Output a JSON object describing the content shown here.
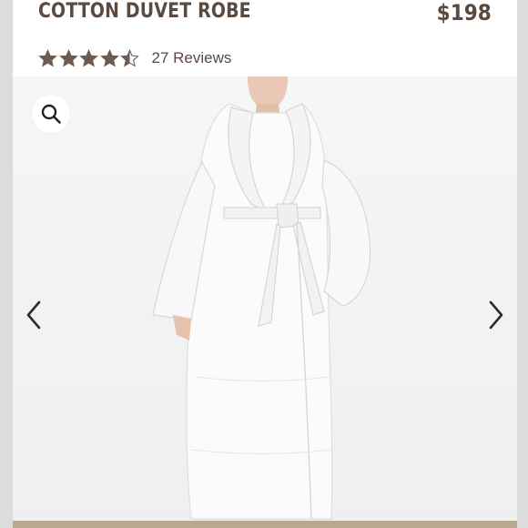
{
  "product": {
    "title": "COTTON DUVET ROBE",
    "price": "$198",
    "rating": 4.5,
    "rating_max": 5,
    "reviews_label": "27 Reviews"
  },
  "icons": {
    "zoom": "search-icon",
    "prev": "chevron-left-icon",
    "next": "chevron-right-icon",
    "star": "star-icon"
  },
  "colors": {
    "text": "#5a4a40",
    "star": "#6b5b50",
    "background": "#ffffff"
  }
}
